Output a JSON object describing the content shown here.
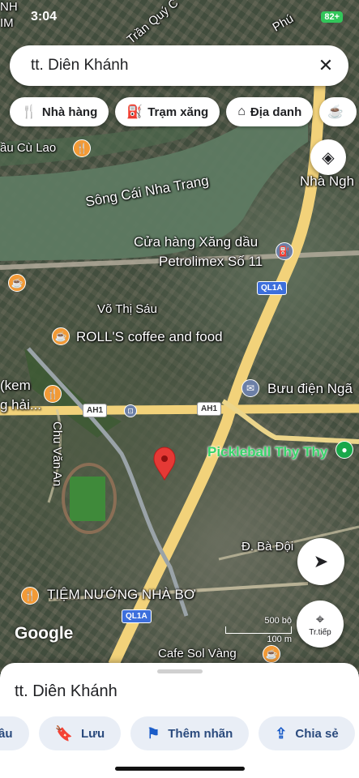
{
  "status": {
    "time": "3:04",
    "battery": "82+"
  },
  "search": {
    "query": "tt. Diên Khánh",
    "close_icon": "close-icon"
  },
  "chips": [
    {
      "label": "Nhà hàng",
      "icon": "restaurant-icon"
    },
    {
      "label": "Trạm xăng",
      "icon": "gas-station-icon"
    },
    {
      "label": "Địa danh",
      "icon": "landmark-icon"
    }
  ],
  "map": {
    "labels": {
      "river": "Sông Cái Nha Trang",
      "cau_cu_lao": "ầu Cù Lao",
      "nha_nghi": "Nhà Ngh",
      "gas_station": "Cửa hàng Xăng dầu",
      "gas_station_2": "Petrolimex Số 11",
      "vo_thi_sau": "Võ Thị Sáu",
      "rolls": "ROLL'S coffee and food",
      "kem": "(kem",
      "hai": "g hải...",
      "post_office": "Bưu điện Ngã",
      "pickleball": "Pickleball Thy Thy",
      "chu_van_an": "Chu Văn An",
      "ba_doi": "Đ. Bà Đội",
      "tiem_nuong": "TIỆM NƯỚNG NHÀ BƠ",
      "cafe": "Cafe Sol Vàng",
      "tran_quy": "Trần Quý C",
      "phu": "Phú",
      "nh": "NH",
      "im": "IM"
    },
    "shields": {
      "ql1a_top": "QL1A",
      "ql1a_mid": "QL1A",
      "ql1a_bottom": "QL1A",
      "ah1_left": "AH1",
      "ah1_right": "AH1"
    },
    "google_logo": "Google",
    "scale": {
      "imperial": "500 bộ",
      "metric": "100 m"
    },
    "streetview_label": "Tr.tiếp"
  },
  "sheet": {
    "place": "tt. Diên Khánh",
    "actions": [
      {
        "label": "ầu",
        "icon": ""
      },
      {
        "label": "Lưu",
        "icon": "bookmark-icon"
      },
      {
        "label": "Thêm nhãn",
        "icon": "flag-icon"
      },
      {
        "label": "Chia sẻ",
        "icon": "share-icon"
      }
    ]
  }
}
